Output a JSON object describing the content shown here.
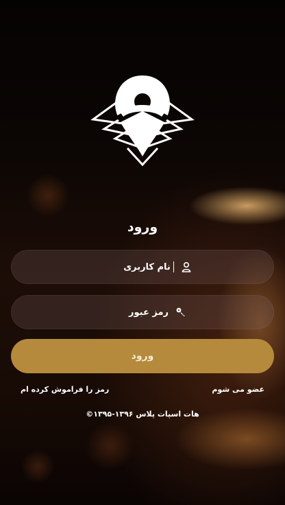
{
  "app": {
    "logo_icon": "location-pin-wifi-icon"
  },
  "login": {
    "title": "ورود",
    "username_placeholder": "نام کاربری",
    "username_icon": "user-icon",
    "password_placeholder": "رمز عبور",
    "password_icon": "key-icon",
    "submit_label": "ورود",
    "forgot_password": "رمز را فراموش کرده ام",
    "register": "عضو می شوم",
    "copyright": "©۱۳۹۵-۱۳۹۶ هات اسپات پلاس"
  },
  "colors": {
    "accent": "#b68a3c",
    "field_bg": "#785f5f",
    "text": "#ffffff"
  }
}
